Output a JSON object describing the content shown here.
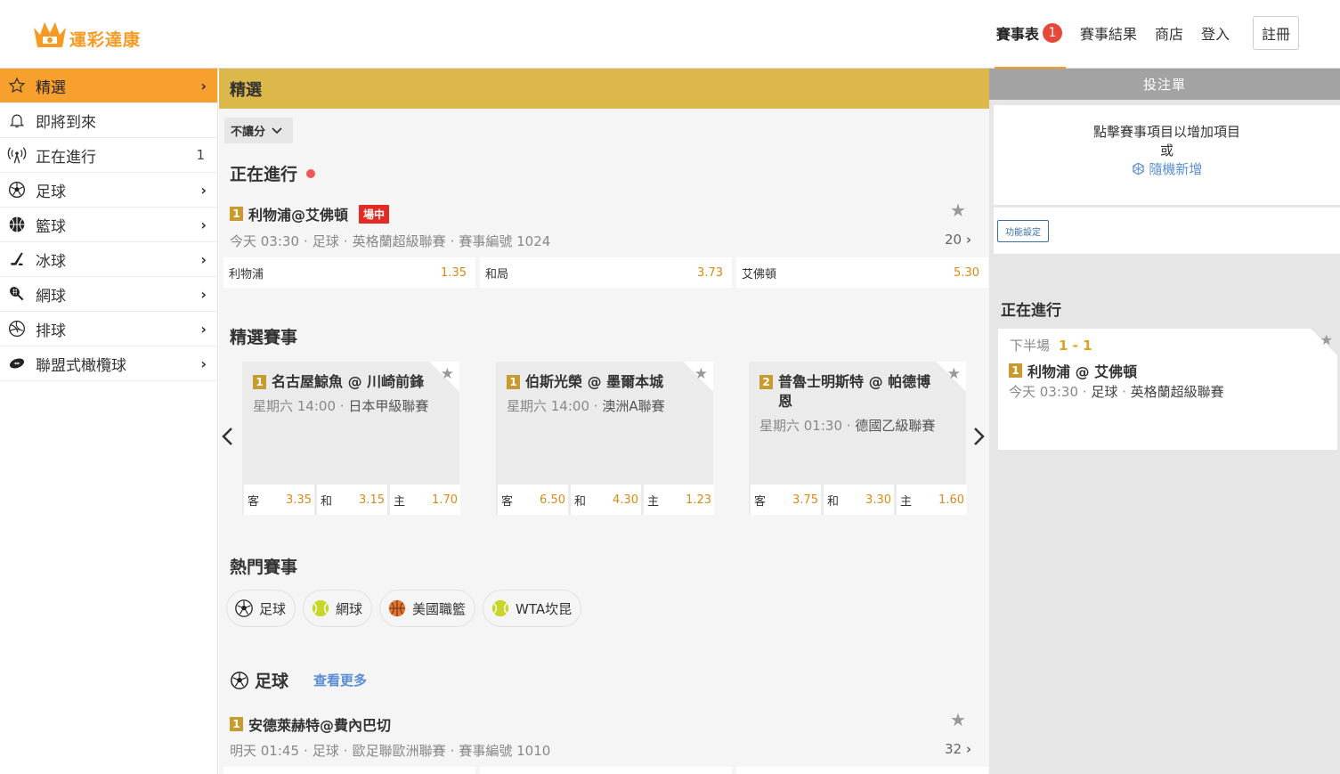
{
  "brand": {
    "name": "運彩達康",
    "accent": "#f59a23"
  },
  "topnav": {
    "schedule": "賽事表",
    "schedule_badge": "1",
    "results": "賽事結果",
    "shop": "商店",
    "login": "登入",
    "register": "註冊"
  },
  "sidebar": {
    "items": [
      {
        "label": "精選",
        "icon": "star-icon"
      },
      {
        "label": "即將到來",
        "icon": "bell-icon"
      },
      {
        "label": "正在進行",
        "icon": "broadcast-icon",
        "count": "1"
      },
      {
        "label": "足球",
        "icon": "soccer-icon"
      },
      {
        "label": "籃球",
        "icon": "basketball-icon"
      },
      {
        "label": "冰球",
        "icon": "hockey-icon"
      },
      {
        "label": "網球",
        "icon": "tennis-racket-icon"
      },
      {
        "label": "排球",
        "icon": "volleyball-icon"
      },
      {
        "label": "聯盟式橄欖球",
        "icon": "rugby-icon"
      }
    ]
  },
  "main": {
    "title": "精選",
    "filter": "不讓分",
    "live_section": "正在進行",
    "live_match": {
      "num": "1",
      "title": "利物浦@艾佛頓",
      "tag": "場中",
      "time": "今天 03:30",
      "sport": "足球",
      "league": "英格蘭超級聯賽",
      "event_no": "賽事編號 1024",
      "markets": "20",
      "odds": [
        {
          "label": "利物浦",
          "value": "1.35"
        },
        {
          "label": "和局",
          "value": "3.73"
        },
        {
          "label": "艾佛頓",
          "value": "5.30"
        }
      ]
    },
    "featured_section": "精選賽事",
    "featured": [
      {
        "num": "1",
        "title": "名古屋鯨魚 @ 川崎前鋒",
        "time": "星期六 14:00",
        "league": "日本甲級聯賽",
        "odds": [
          {
            "label": "客",
            "value": "3.35"
          },
          {
            "label": "和",
            "value": "3.15"
          },
          {
            "label": "主",
            "value": "1.70"
          }
        ]
      },
      {
        "num": "1",
        "title": "伯斯光榮 @ 墨爾本城",
        "time": "星期六 14:00",
        "league": "澳洲A聯賽",
        "odds": [
          {
            "label": "客",
            "value": "6.50"
          },
          {
            "label": "和",
            "value": "4.30"
          },
          {
            "label": "主",
            "value": "1.23"
          }
        ]
      },
      {
        "num": "2",
        "title": "普魯士明斯特 @ 帕德博恩",
        "time": "星期六 01:30",
        "league": "德國乙級聯賽",
        "odds": [
          {
            "label": "客",
            "value": "3.75"
          },
          {
            "label": "和",
            "value": "3.30"
          },
          {
            "label": "主",
            "value": "1.60"
          }
        ]
      }
    ],
    "hot_section": "熱門賽事",
    "hot_chips": [
      {
        "label": "足球",
        "icon": "soccer-ball-icon"
      },
      {
        "label": "網球",
        "icon": "tennis-ball-icon"
      },
      {
        "label": "美國職籃",
        "icon": "basketball-ball-icon"
      },
      {
        "label": "WTA坎昆",
        "icon": "tennis-ball-icon"
      }
    ],
    "soccer_section": "足球",
    "see_more": "查看更多",
    "soccer_match": {
      "num": "1",
      "title": "安德萊赫特@費內巴切",
      "time": "明天 01:45",
      "sport": "足球",
      "league": "歐足聯歐洲聯賽",
      "event_no": "賽事編號 1010",
      "markets": "32"
    }
  },
  "betslip": {
    "title": "投注單",
    "hint_line1": "點擊賽事項目以增加項目",
    "hint_line2": "或",
    "random": "隨機新增",
    "settings": "功能設定",
    "live_title": "正在進行",
    "live_card": {
      "period": "下半場",
      "score": "1 - 1",
      "num": "1",
      "teams": "利物浦 @ 艾佛頓",
      "time": "今天 03:30",
      "sport": "足球",
      "league": "英格蘭超級聯賽"
    }
  }
}
